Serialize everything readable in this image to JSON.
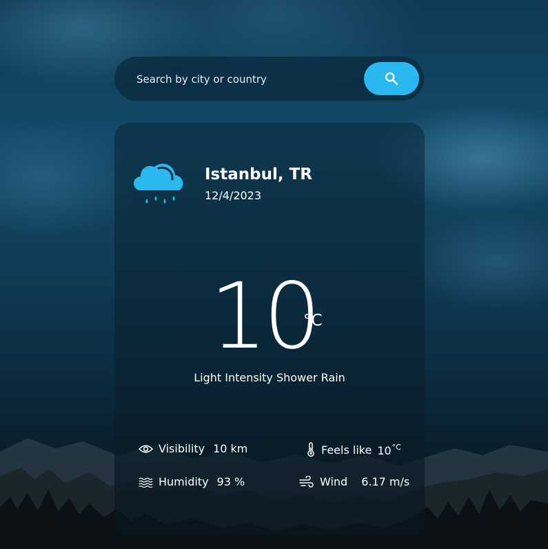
{
  "search": {
    "placeholder": "Search by city or country",
    "icon": "search-icon"
  },
  "location": {
    "city": "Istanbul, TR",
    "date": "12/4/2023"
  },
  "weather": {
    "icon": "rain-cloud-icon",
    "temperature": "10",
    "unit": "°C",
    "description": "Light Intensity Shower Rain"
  },
  "stats": {
    "visibility": {
      "icon": "eye-icon",
      "label": "Visibility",
      "value": "10 km"
    },
    "feels_like": {
      "icon": "thermometer-icon",
      "label": "Feels like",
      "value": "10",
      "unit": "°C"
    },
    "humidity": {
      "icon": "humidity-waves-icon",
      "label": "Humidity",
      "value": "93 %"
    },
    "wind": {
      "icon": "wind-icon",
      "label": "Wind",
      "value": "6.17 m/s"
    }
  },
  "colors": {
    "accent": "#29b8ef",
    "text": "#ffffff"
  }
}
